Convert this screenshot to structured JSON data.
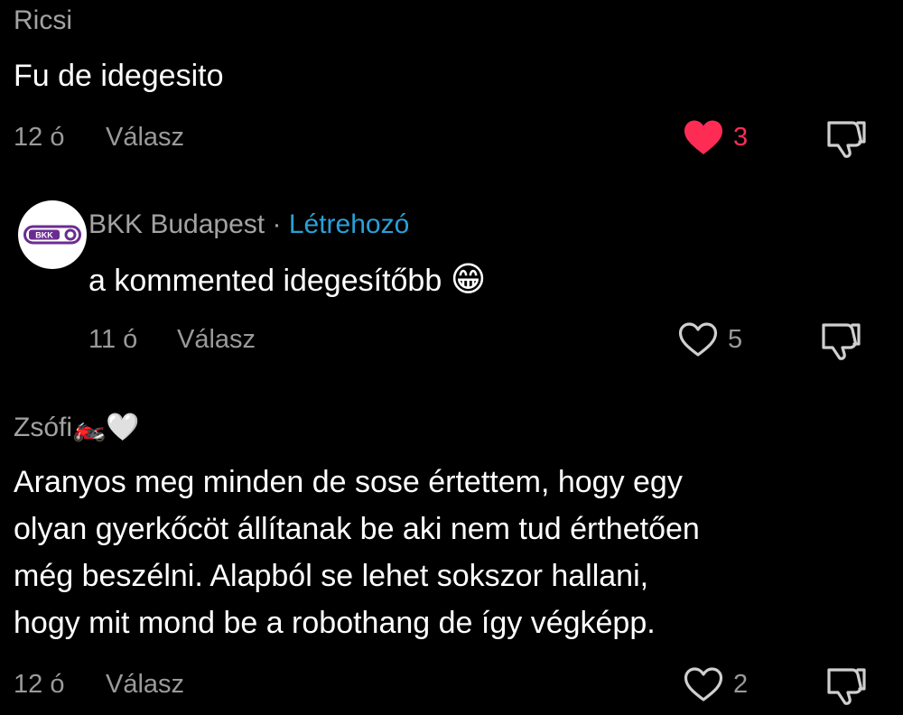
{
  "colors": {
    "background": "#000000",
    "liked": "#fe2c55",
    "creator_badge": "#2aa0d8",
    "bkk_brand": "#6b2c91"
  },
  "comments": [
    {
      "username": "Ricsi",
      "text": "Fu de idegesito",
      "time": "12 ó",
      "reply_label": "Válasz",
      "like_count": "3",
      "liked": true,
      "like_icon": "heart-filled-icon",
      "dislike_icon": "thumbs-down-icon"
    },
    {
      "username": "BKK Budapest",
      "separator": "·",
      "creator_label": "Létrehozó",
      "avatar_text": "BKK",
      "text": "a kommented idegesítőbb",
      "emoji": "😁",
      "time": "11 ó",
      "reply_label": "Válasz",
      "like_count": "5",
      "liked": false,
      "like_icon": "heart-outline-icon",
      "dislike_icon": "thumbs-down-icon"
    },
    {
      "username": "Zsófi",
      "username_emoji": "🏍️🤍",
      "text_lines": [
        "Aranyos meg minden de sose értettem, hogy egy",
        "olyan gyerkőcöt állítanak be aki nem tud érthetően",
        "még beszélni. Alapból se lehet sokszor hallani,",
        "hogy mit mond be a robothang de így végképp."
      ],
      "time": "12 ó",
      "reply_label": "Válasz",
      "like_count": "2",
      "liked": false,
      "like_icon": "heart-outline-icon",
      "dislike_icon": "thumbs-down-icon"
    }
  ]
}
